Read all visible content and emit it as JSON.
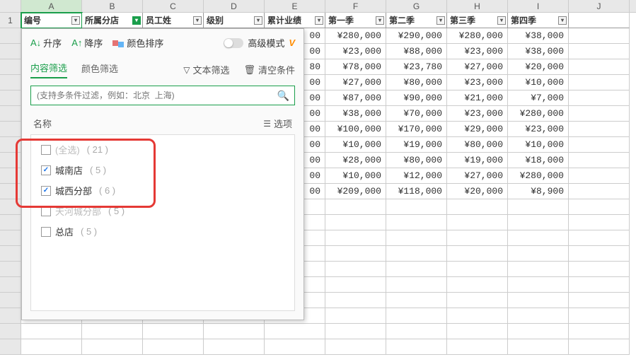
{
  "columns": [
    "A",
    "B",
    "C",
    "D",
    "E",
    "F",
    "G",
    "H",
    "I",
    "J"
  ],
  "row_label": "1",
  "headers": {
    "a": "编号",
    "b": "所属分店",
    "c": "员工姓",
    "d": "级别",
    "e": "累计业绩",
    "f": "第一季",
    "g": "第二季",
    "h": "第三季",
    "i": "第四季"
  },
  "filter_panel": {
    "sort_asc": "升序",
    "sort_desc": "降序",
    "color_sort": "颜色排序",
    "advanced": "高级模式",
    "tab_content": "内容筛选",
    "tab_color": "颜色筛选",
    "text_filter": "文本筛选",
    "clear": "清空条件",
    "search_placeholder": "(支持多条件过滤，例如：北京  上海)",
    "list_header": "名称",
    "options": "选项",
    "items": [
      {
        "label": "(全选)",
        "count": "( 21 )",
        "checked": false,
        "dim": true
      },
      {
        "label": "城南店",
        "count": "( 5 )",
        "checked": true,
        "dim": false
      },
      {
        "label": "城西分部",
        "count": "( 6 )",
        "checked": true,
        "dim": false
      },
      {
        "label": "天河城分部",
        "count": "( 5 )",
        "checked": false,
        "dim": true
      },
      {
        "label": "总店",
        "count": "( 5 )",
        "checked": false,
        "dim": false
      }
    ]
  },
  "chart_data": {
    "type": "table",
    "columns": [
      "第一季",
      "第二季",
      "第三季",
      "第四季"
    ],
    "rows": [
      [
        "¥280,000",
        "¥290,000",
        "¥280,000",
        "¥38,000"
      ],
      [
        "¥23,000",
        "¥88,000",
        "¥23,000",
        "¥38,000"
      ],
      [
        "¥78,000",
        "¥23,780",
        "¥27,000",
        "¥20,000"
      ],
      [
        "¥27,000",
        "¥80,000",
        "¥23,000",
        "¥10,000"
      ],
      [
        "¥87,000",
        "¥90,000",
        "¥21,000",
        "¥7,000"
      ],
      [
        "¥38,000",
        "¥70,000",
        "¥23,000",
        "¥280,000"
      ],
      [
        "¥100,000",
        "¥170,000",
        "¥29,000",
        "¥23,000"
      ],
      [
        "¥10,000",
        "¥19,000",
        "¥80,000",
        "¥10,000"
      ],
      [
        "¥28,000",
        "¥80,000",
        "¥19,000",
        "¥18,000"
      ],
      [
        "¥10,000",
        "¥12,000",
        "¥27,000",
        "¥280,000"
      ],
      [
        "¥209,000",
        "¥118,000",
        "¥20,000",
        "¥8,900"
      ]
    ],
    "partial_col_e": [
      "00",
      "00",
      "80",
      "00",
      "00",
      "00",
      "00",
      "00",
      "00",
      "00",
      "00"
    ]
  }
}
